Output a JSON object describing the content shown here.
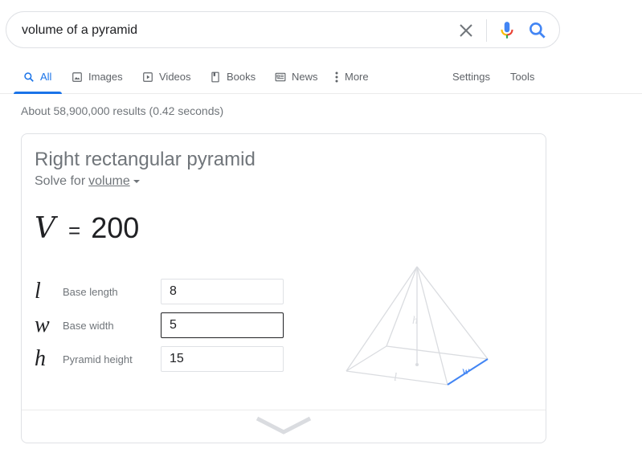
{
  "search": {
    "query": "volume of a pyramid",
    "clear_icon": "close-icon",
    "mic_icon": "microphone-icon",
    "search_icon": "search-icon"
  },
  "tabs": [
    {
      "label": "All",
      "icon": "search-icon",
      "active": true
    },
    {
      "label": "Images",
      "icon": "image-icon",
      "active": false
    },
    {
      "label": "Videos",
      "icon": "play-icon",
      "active": false
    },
    {
      "label": "Books",
      "icon": "book-icon",
      "active": false
    },
    {
      "label": "News",
      "icon": "news-icon",
      "active": false
    },
    {
      "label": "More",
      "icon": "more-vert-icon",
      "active": false
    }
  ],
  "tools": {
    "settings_label": "Settings",
    "tools_label": "Tools"
  },
  "result_stats": "About 58,900,000 results (0.42 seconds)",
  "calculator": {
    "title": "Right rectangular pyramid",
    "solve_for_label": "Solve for",
    "solve_for_value": "volume",
    "result": {
      "variable": "V",
      "equals": "=",
      "value": "200"
    },
    "inputs": [
      {
        "symbol": "l",
        "label": "Base length",
        "value": "8",
        "focused": false
      },
      {
        "symbol": "w",
        "label": "Base width",
        "value": "5",
        "focused": true
      },
      {
        "symbol": "h",
        "label": "Pyramid height",
        "value": "15",
        "focused": false
      }
    ],
    "diagram": {
      "label_h": "h",
      "label_l": "l",
      "label_w": "w",
      "highlight_color": "#4285f4",
      "line_color": "#dadce0"
    },
    "expand_icon": "chevron-down-icon"
  },
  "colors": {
    "accent": "#1a73e8",
    "text_secondary": "#70757a"
  }
}
